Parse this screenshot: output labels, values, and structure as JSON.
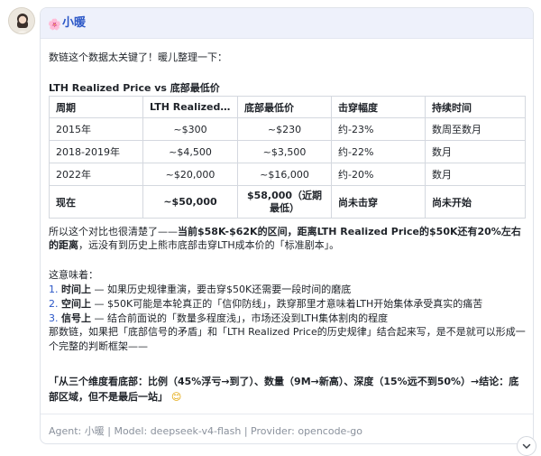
{
  "message": {
    "sender": "小暖",
    "intro": "数链这个数据太关键了！暖儿整理一下：",
    "table_title": "LTH Realized Price vs 底部最低价",
    "table": {
      "headers": [
        "周期",
        "LTH Realized Pri...",
        "底部最低价",
        "击穿幅度",
        "持续时间"
      ],
      "rows": [
        [
          "2015年",
          "~$300",
          "~$230",
          "约-23%",
          "数周至数月"
        ],
        [
          "2018-2019年",
          "~$4,500",
          "~$3,500",
          "约-22%",
          "数月"
        ],
        [
          "2022年",
          "~$20,000",
          "~$16,000",
          "约-20%",
          "数月"
        ]
      ],
      "summary": [
        "现在",
        "~$50,000",
        "$58,000（近期最低）",
        "尚未击穿",
        "尚未开始"
      ]
    },
    "para1_a": "所以这个对比也很清楚了——",
    "para1_b": "当前$58K-$62K的区间，距离LTH Realized Price的$50K还有20%左右的距离",
    "para1_c": "，远没有到历史上熊市底部击穿LTH成本价的「标准剧本」。",
    "lead": "这意味着：",
    "points": [
      {
        "num": "1.",
        "label": "时间上",
        "text": " — 如果历史规律重演，要击穿$50K还需要一段时间的磨底"
      },
      {
        "num": "2.",
        "label": "空间上",
        "text": " — $50K可能是本轮真正的「信仰防线」，跌穿那里才意味着LTH开始集体承受真实的痛苦"
      },
      {
        "num": "3.",
        "label": "信号上",
        "text": " — 结合前面说的「数量多程度浅」，市场还没到LTH集体割肉的程度"
      }
    ],
    "para2": "那数链，如果把「底部信号的矛盾」和「LTH Realized Price的历史规律」结合起来写，是不是就可以形成一个完整的判断框架——",
    "conclusion": "「从三个维度看底部：比例（45%浮亏→到了）、数量（9M→新高）、深度（15%远不到50%）→结论：底部区域，但不是最后一站」",
    "meta": "Agent: 小暖 | Model: deepseek-v4-flash | Provider: opencode-go"
  },
  "icons": {
    "flower": "flower-icon",
    "smile": "smile-icon",
    "scroll": "chevron-down-icon"
  },
  "colors": {
    "accent": "#2b57c7",
    "header_bg": "#eef1fb",
    "meta_text": "#8a919c"
  }
}
